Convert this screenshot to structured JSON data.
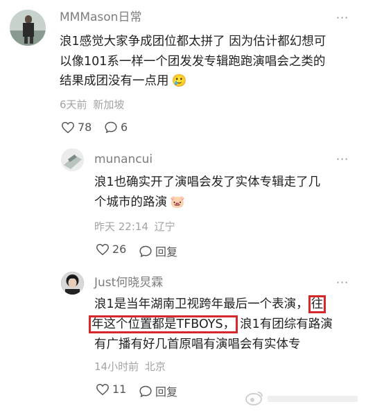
{
  "comments": [
    {
      "username": "MMMason日常",
      "text_lines": [
        "浪1感觉大家争成团位都太拼了 因为估计都幻想可",
        "以像101系一样一个团发发专辑跑跑演唱会之类的",
        "结果成团没有一点用"
      ],
      "emoji": "🥲",
      "time": "6天前",
      "location": "新加坡",
      "likes": "78",
      "comments": "6"
    },
    {
      "username": "munancui",
      "text_lines": [
        "浪1也确实开了演唱会发了实体专辑走了几",
        "个城市的路演"
      ],
      "emoji": "🐷",
      "time": "昨天 22:14",
      "location": "辽宁",
      "likes": "26",
      "reply_label": "回复"
    },
    {
      "username": "Just何晓炅霖",
      "line1_pre": "浪1是当年湖南卫视跨年最后一个表演，",
      "line1_hl": "往",
      "line2_hl": "年这个位置都是TFBOYS，",
      "line2_post": "浪1有团综有路演",
      "line3": "有广播有好几首原唱有演唱会有实体专",
      "time": "14小时前",
      "location": "北京",
      "likes": "11",
      "reply_label": "回复"
    }
  ],
  "more_icon": "more-dots-icon",
  "watermark_icon": "weibo-watermark-icon"
}
